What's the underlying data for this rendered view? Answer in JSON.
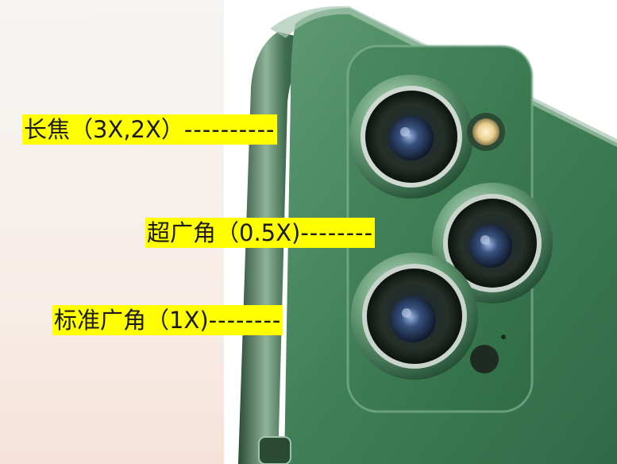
{
  "labels": {
    "telephoto": {
      "name": "长焦",
      "zoom": "（3X,2X）",
      "leader": "----------"
    },
    "ultrawide": {
      "name": "超广角",
      "zoom": "（0.5X)",
      "leader": "--------"
    },
    "wide": {
      "name": "标准广角",
      "zoom": "（1X)",
      "leader": "--------"
    }
  },
  "colors": {
    "highlight": "#ffff00",
    "phone_green": "#3f7a55",
    "phone_dark": "#1f4430",
    "background": "#f4f3f1"
  }
}
